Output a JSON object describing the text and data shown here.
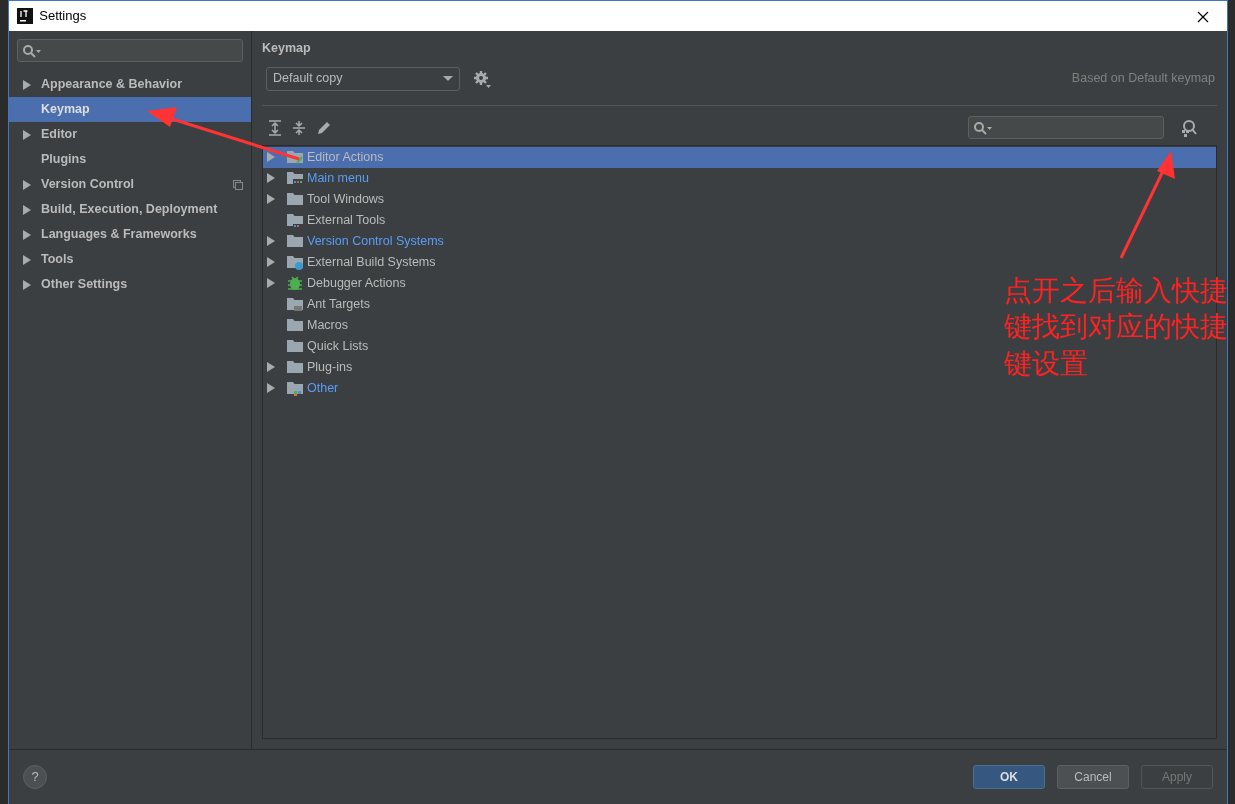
{
  "window": {
    "title": "Settings"
  },
  "sidebar": {
    "items": [
      {
        "label": "Appearance & Behavior",
        "expandable": true,
        "selected": false,
        "project_scope": false
      },
      {
        "label": "Keymap",
        "expandable": false,
        "selected": true,
        "project_scope": false
      },
      {
        "label": "Editor",
        "expandable": true,
        "selected": false,
        "project_scope": false
      },
      {
        "label": "Plugins",
        "expandable": false,
        "selected": false,
        "project_scope": false
      },
      {
        "label": "Version Control",
        "expandable": true,
        "selected": false,
        "project_scope": true
      },
      {
        "label": "Build, Execution, Deployment",
        "expandable": true,
        "selected": false,
        "project_scope": false
      },
      {
        "label": "Languages & Frameworks",
        "expandable": true,
        "selected": false,
        "project_scope": false
      },
      {
        "label": "Tools",
        "expandable": true,
        "selected": false,
        "project_scope": false
      },
      {
        "label": "Other Settings",
        "expandable": true,
        "selected": false,
        "project_scope": false
      }
    ]
  },
  "panel": {
    "title": "Keymap",
    "keymap": "Default copy",
    "based_on": "Based on Default keymap"
  },
  "tree": [
    {
      "label": "Editor Actions",
      "kind": "editor",
      "expandable": true,
      "modified": false,
      "selected": true
    },
    {
      "label": "Main menu",
      "kind": "menu",
      "expandable": true,
      "modified": true,
      "selected": false
    },
    {
      "label": "Tool Windows",
      "kind": "folder",
      "expandable": true,
      "modified": false,
      "selected": false
    },
    {
      "label": "External Tools",
      "kind": "tools",
      "expandable": false,
      "modified": false,
      "selected": false
    },
    {
      "label": "Version Control Systems",
      "kind": "folder",
      "expandable": true,
      "modified": true,
      "selected": false
    },
    {
      "label": "External Build Systems",
      "kind": "build",
      "expandable": true,
      "modified": false,
      "selected": false
    },
    {
      "label": "Debugger Actions",
      "kind": "bug",
      "expandable": true,
      "modified": false,
      "selected": false
    },
    {
      "label": "Ant Targets",
      "kind": "ant",
      "expandable": false,
      "modified": false,
      "selected": false
    },
    {
      "label": "Macros",
      "kind": "folder",
      "expandable": false,
      "modified": false,
      "selected": false
    },
    {
      "label": "Quick Lists",
      "kind": "folder",
      "expandable": false,
      "modified": false,
      "selected": false
    },
    {
      "label": "Plug-ins",
      "kind": "folder",
      "expandable": true,
      "modified": false,
      "selected": false
    },
    {
      "label": "Other",
      "kind": "other",
      "expandable": true,
      "modified": true,
      "selected": false
    }
  ],
  "annotation": {
    "text": "点开之后输入快捷键找到对应的快捷键设置"
  },
  "buttons": [
    {
      "label": "OK",
      "kind": "primary",
      "disabled": false
    },
    {
      "label": "Cancel",
      "kind": "normal",
      "disabled": false
    },
    {
      "label": "Apply",
      "kind": "normal",
      "disabled": true
    }
  ],
  "help": {
    "label": "?"
  }
}
